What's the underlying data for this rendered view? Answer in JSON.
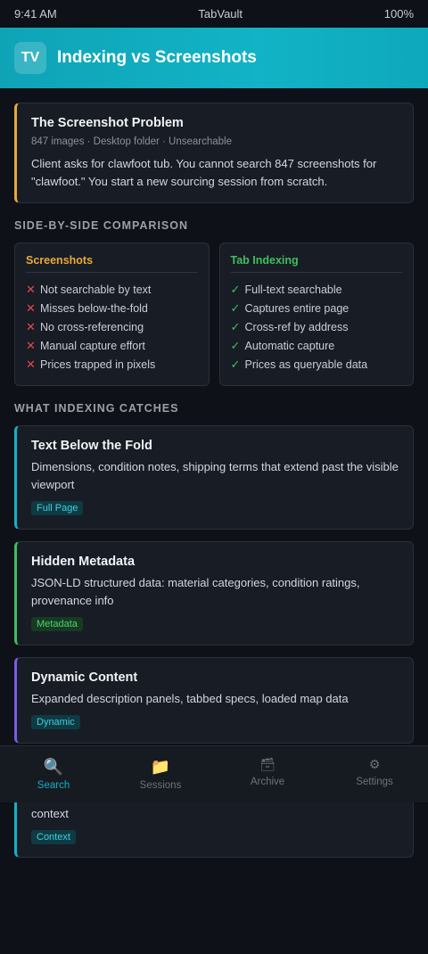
{
  "status_bar": {
    "time": "9:41 AM",
    "app": "TabVault",
    "battery": "100%"
  },
  "header": {
    "logo": "TV",
    "title": "Indexing vs Screenshots"
  },
  "problem": {
    "title": "The Screenshot Problem",
    "meta": "847 images · Desktop folder · Unsearchable",
    "description": "Client asks for clawfoot tub. You cannot search 847 screenshots for \"clawfoot.\" You start a new sourcing session from scratch."
  },
  "comparison": {
    "section_label": "SIDE-BY-SIDE COMPARISON",
    "screenshots": {
      "title": "Screenshots",
      "mark": "✕",
      "items": [
        "Not searchable by text",
        "Misses below-the-fold",
        "No cross-referencing",
        "Manual capture effort",
        "Prices trapped in pixels"
      ]
    },
    "indexing": {
      "title": "Tab Indexing",
      "mark": "✓",
      "items": [
        "Full-text searchable",
        "Captures entire page",
        "Cross-ref by address",
        "Automatic capture",
        "Prices as queryable data"
      ]
    }
  },
  "catches": {
    "section_label": "WHAT INDEXING CATCHES",
    "cards": [
      {
        "title": "Text Below the Fold",
        "description": "Dimensions, condition notes, shipping terms that extend past the visible viewport",
        "tag": "Full Page"
      },
      {
        "title": "Hidden Metadata",
        "description": "JSON-LD structured data: material categories, condition ratings, provenance info",
        "tag": "Metadata"
      },
      {
        "title": "Dynamic Content",
        "description": "Expanded description panels, tabbed specs, loaded map data",
        "tag": "Dynamic"
      }
    ],
    "hidden_card": {
      "visible_text": "context",
      "tag": "Context"
    }
  },
  "bottom_nav": {
    "items": [
      {
        "label": "Search",
        "icon": "magnifier-icon",
        "glyph": "🔍",
        "active": true
      },
      {
        "label": "Sessions",
        "icon": "folder-icon",
        "glyph": "📁",
        "active": false
      },
      {
        "label": "Archive",
        "icon": "archive-box-icon",
        "glyph": "🗃",
        "active": false
      },
      {
        "label": "Settings",
        "icon": "gear-icon",
        "glyph": "⚙",
        "active": false
      }
    ]
  },
  "colors": {
    "accent_teal": "#12b3c6",
    "accent_amber": "#e8a93b",
    "accent_green": "#3fbf5f",
    "accent_purple": "#7c5ce8",
    "error_red": "#e5484d",
    "background": "#0e1117"
  }
}
